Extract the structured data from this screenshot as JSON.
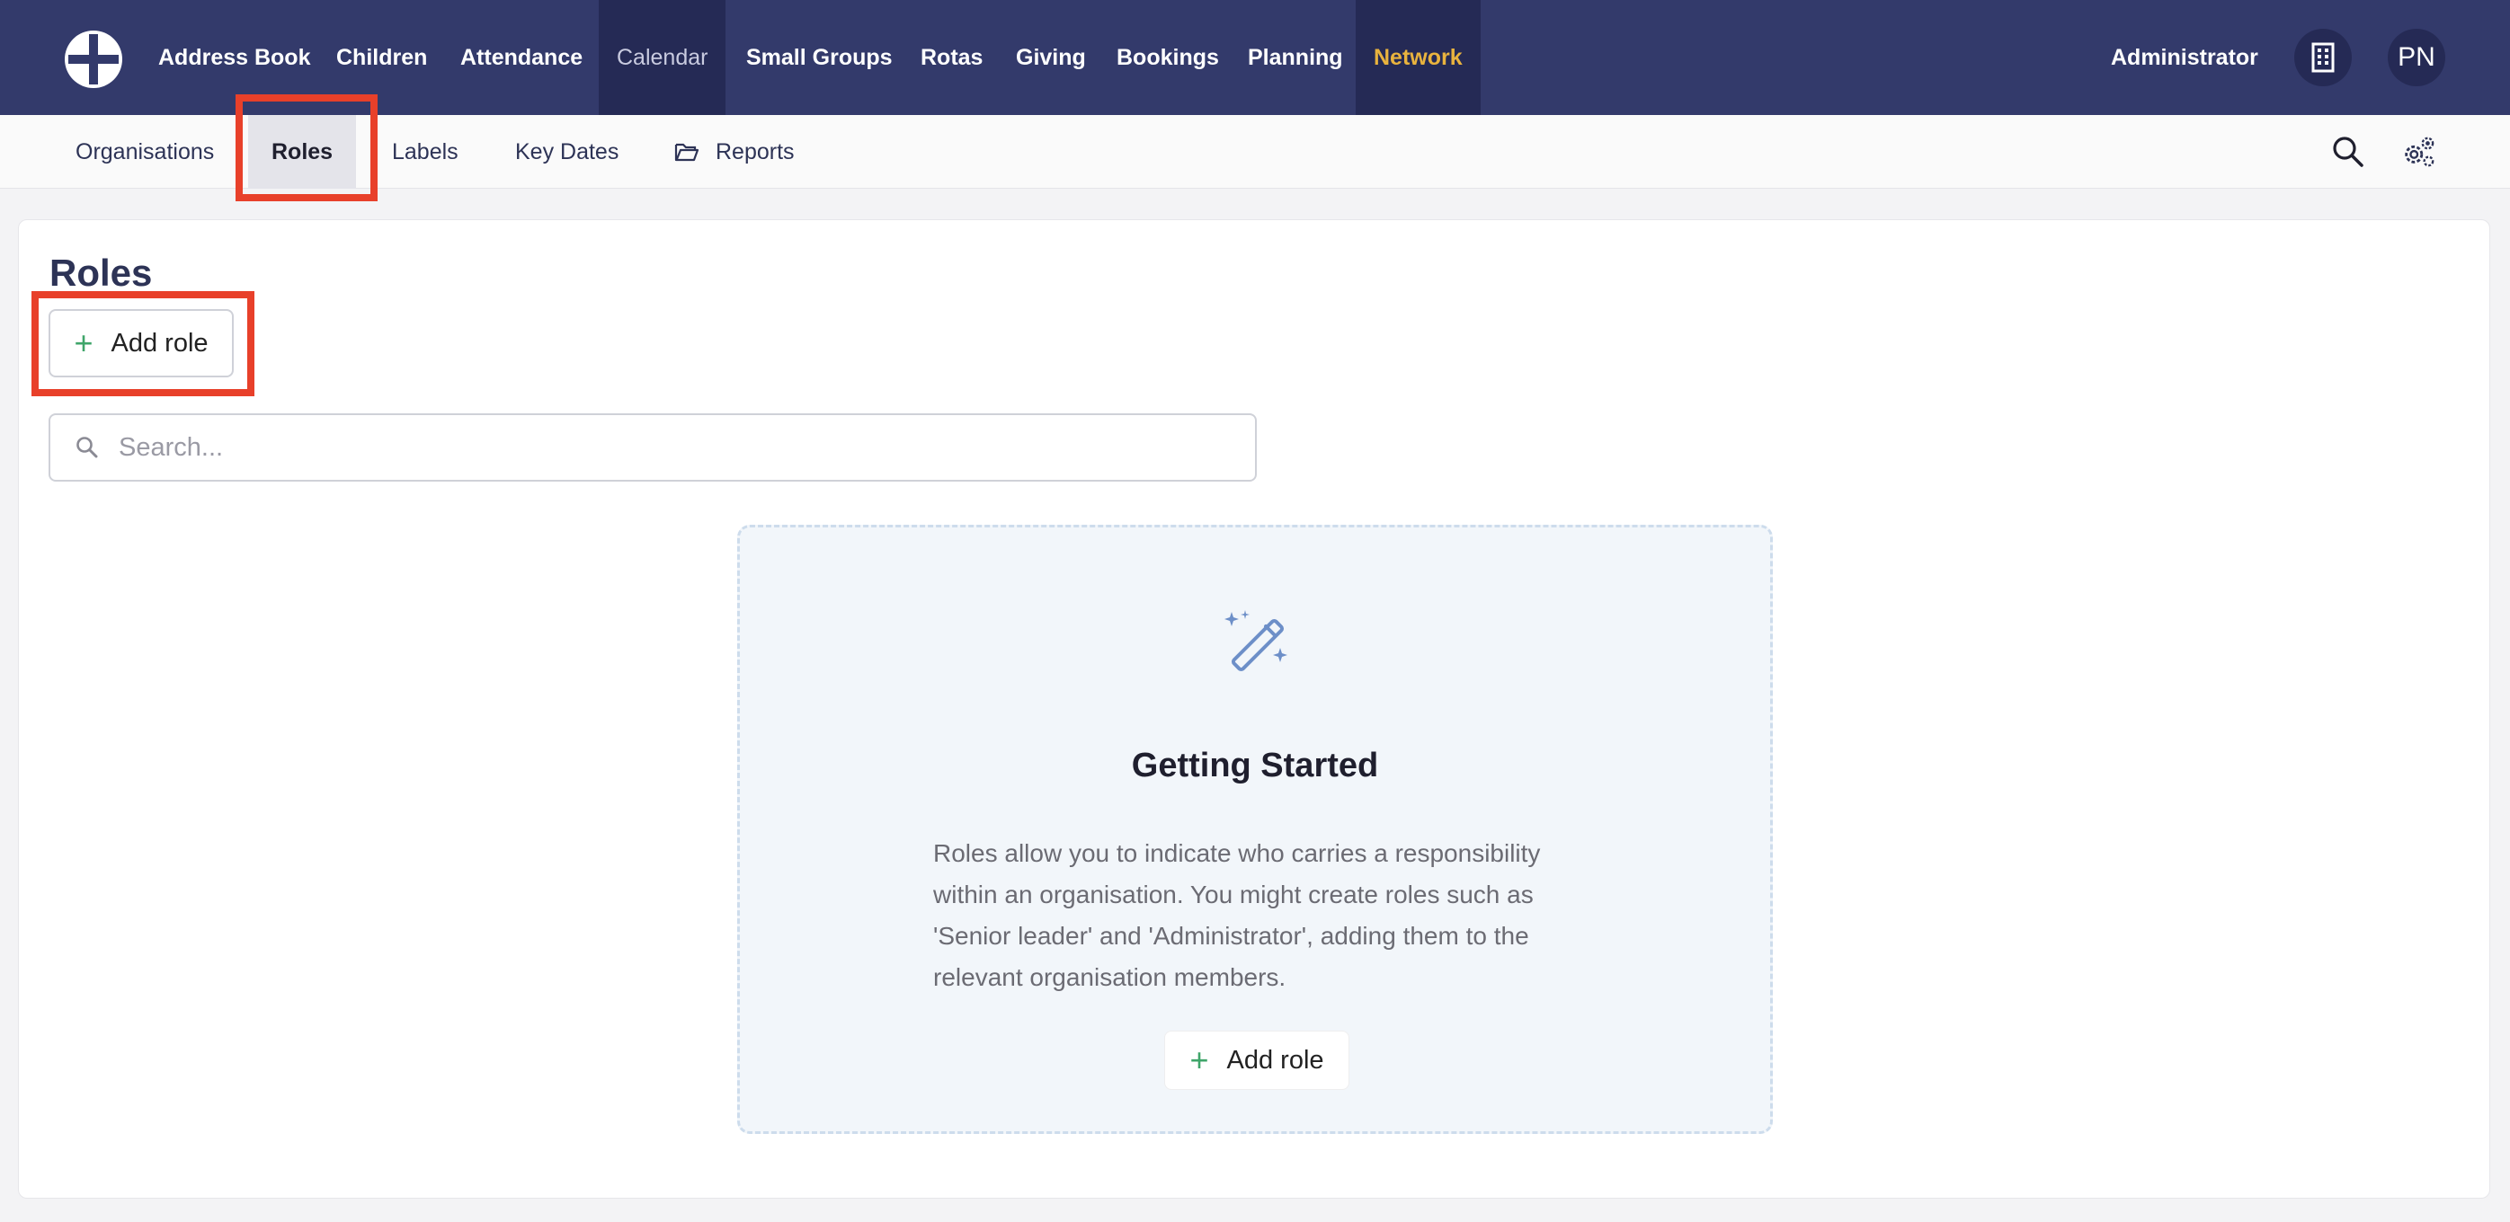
{
  "nav": {
    "items": [
      {
        "label": "Address Book"
      },
      {
        "label": "Children"
      },
      {
        "label": "Attendance"
      },
      {
        "label": "Calendar"
      },
      {
        "label": "Small Groups"
      },
      {
        "label": "Rotas"
      },
      {
        "label": "Giving"
      },
      {
        "label": "Bookings"
      },
      {
        "label": "Planning"
      },
      {
        "label": "Network"
      }
    ],
    "user": "Administrator",
    "avatar_initials": "PN",
    "accent_color": "#e9b33e"
  },
  "subnav": {
    "items": [
      {
        "label": "Organisations"
      },
      {
        "label": "Roles"
      },
      {
        "label": "Labels"
      },
      {
        "label": "Key Dates"
      },
      {
        "label": "Reports"
      }
    ]
  },
  "main": {
    "title": "Roles",
    "add_label": "Add role",
    "search_placeholder": "Search..."
  },
  "empty_state": {
    "title": "Getting Started",
    "text": "Roles allow you to indicate who carries a responsibility within an organisation. You might create roles such as 'Senior leader' and 'Administrator', adding them to the relevant organisation members.",
    "button_label": "Add role"
  },
  "icons": [
    "app-logo-icon",
    "building-icon",
    "folder-open-icon",
    "search-icon",
    "settings-gears-icon",
    "plus-icon",
    "magic-wand-icon"
  ]
}
